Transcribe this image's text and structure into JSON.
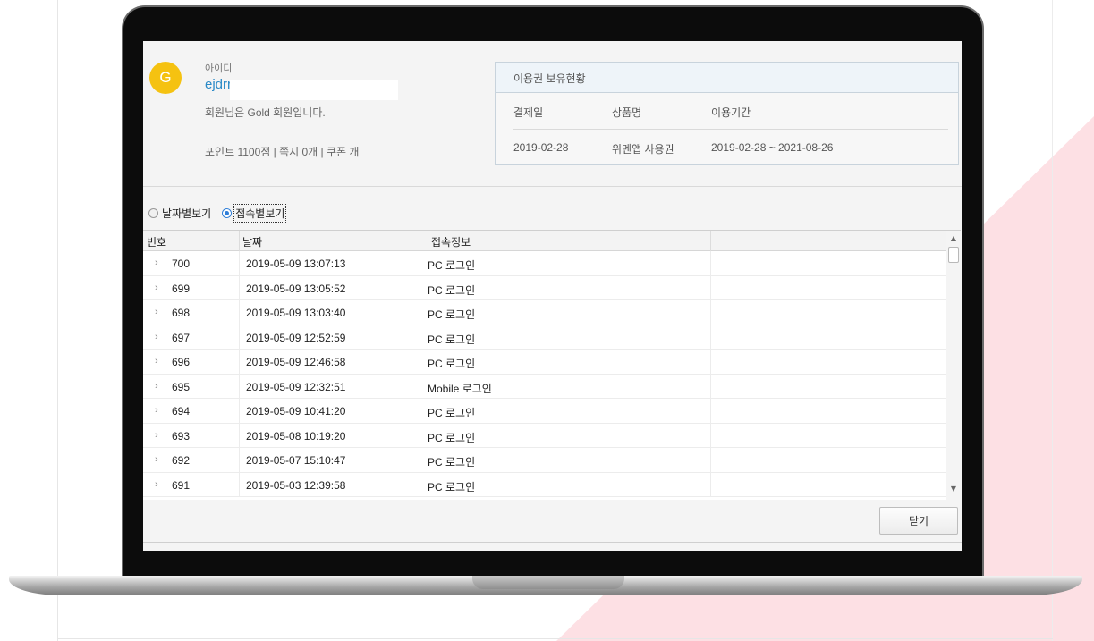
{
  "profile": {
    "avatar_letter": "G",
    "id_label": "아이디",
    "id_value": "ejdrr",
    "member_text": "회원님은 Gold 회원입니다.",
    "stats_text": "포인트 1100점 | 쪽지 0개 | 쿠폰 개"
  },
  "tickets": {
    "title": "이용권 보유현황",
    "headers": [
      "결제일",
      "상품명",
      "이용기간"
    ],
    "rows": [
      [
        "2019-02-28",
        "위멘앱 사용권",
        "2019-02-28 ~ 2021-08-26"
      ]
    ]
  },
  "view_options": {
    "by_date": "날짜별보기",
    "by_access": "접속별보기",
    "selected": "by_access"
  },
  "grid": {
    "columns": [
      "번호",
      "날짜",
      "접속정보",
      ""
    ],
    "rows": [
      {
        "chev": "›",
        "num": "700",
        "date": "2019-05-09 13:07:13",
        "info": "PC 로그인"
      },
      {
        "chev": "›",
        "num": "699",
        "date": "2019-05-09 13:05:52",
        "info": "PC 로그인"
      },
      {
        "chev": "›",
        "num": "698",
        "date": "2019-05-09 13:03:40",
        "info": "PC 로그인"
      },
      {
        "chev": "›",
        "num": "697",
        "date": "2019-05-09 12:52:59",
        "info": "PC 로그인"
      },
      {
        "chev": "›",
        "num": "696",
        "date": "2019-05-09 12:46:58",
        "info": "PC 로그인"
      },
      {
        "chev": "›",
        "num": "695",
        "date": "2019-05-09 12:32:51",
        "info": "Mobile 로그인"
      },
      {
        "chev": "›",
        "num": "694",
        "date": "2019-05-09 10:41:20",
        "info": "PC 로그인"
      },
      {
        "chev": "›",
        "num": "693",
        "date": "2019-05-08 10:19:20",
        "info": "PC 로그인"
      },
      {
        "chev": "›",
        "num": "692",
        "date": "2019-05-07 15:10:47",
        "info": "PC 로그인"
      },
      {
        "chev": "›",
        "num": "691",
        "date": "2019-05-03 12:39:58",
        "info": "PC 로그인"
      }
    ]
  },
  "buttons": {
    "close": "닫기"
  },
  "colors": {
    "avatar": "#f5c211",
    "id_text": "#2a8ac7",
    "radio_accent": "#2f7ed8",
    "pink_accent": "#fde0e4"
  }
}
